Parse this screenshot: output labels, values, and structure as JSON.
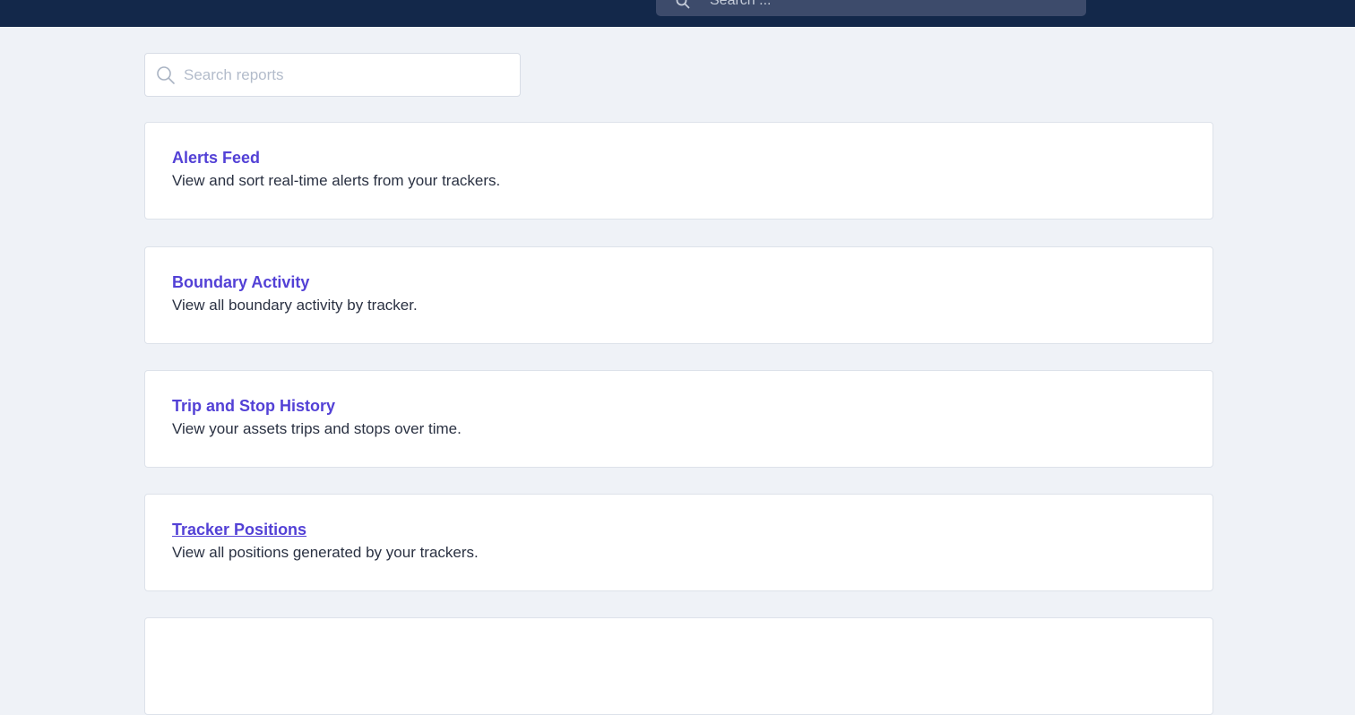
{
  "header": {
    "search_placeholder": "Search ..."
  },
  "reports_search": {
    "placeholder": "Search reports"
  },
  "reports": [
    {
      "title": "Alerts Feed",
      "description": "View and sort real-time alerts from your trackers."
    },
    {
      "title": "Boundary Activity",
      "description": "View all boundary activity by tracker."
    },
    {
      "title": "Trip and Stop History",
      "description": "View your assets trips and stops over time."
    },
    {
      "title": "Tracker Positions",
      "description": "View all positions generated by your trackers."
    },
    {
      "title": "",
      "description": ""
    }
  ],
  "colors": {
    "topbar": "#13284a",
    "accent": "#5341d6",
    "background": "#eff2f7"
  },
  "icons": {
    "header_search": "search-icon",
    "reports_search": "search-icon"
  }
}
